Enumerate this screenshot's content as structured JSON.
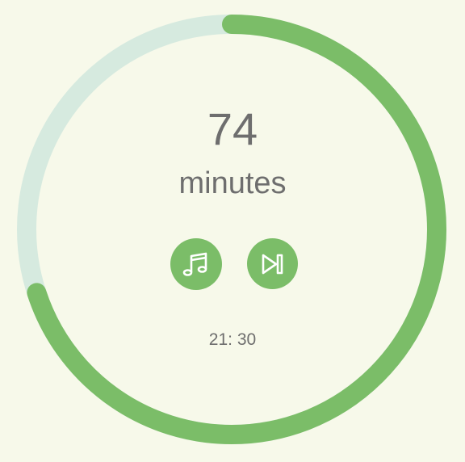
{
  "timer": {
    "value": "74",
    "unit": "minutes",
    "clock": "21: 30",
    "progress": 0.7
  },
  "buttons": {
    "music": {
      "icon": "music-note-icon"
    },
    "skip": {
      "icon": "skip-forward-icon"
    }
  },
  "colors": {
    "background": "#f7f9ea",
    "accent": "#7bbd68",
    "track": "#d6eadf",
    "text": "#6e6e6e"
  }
}
